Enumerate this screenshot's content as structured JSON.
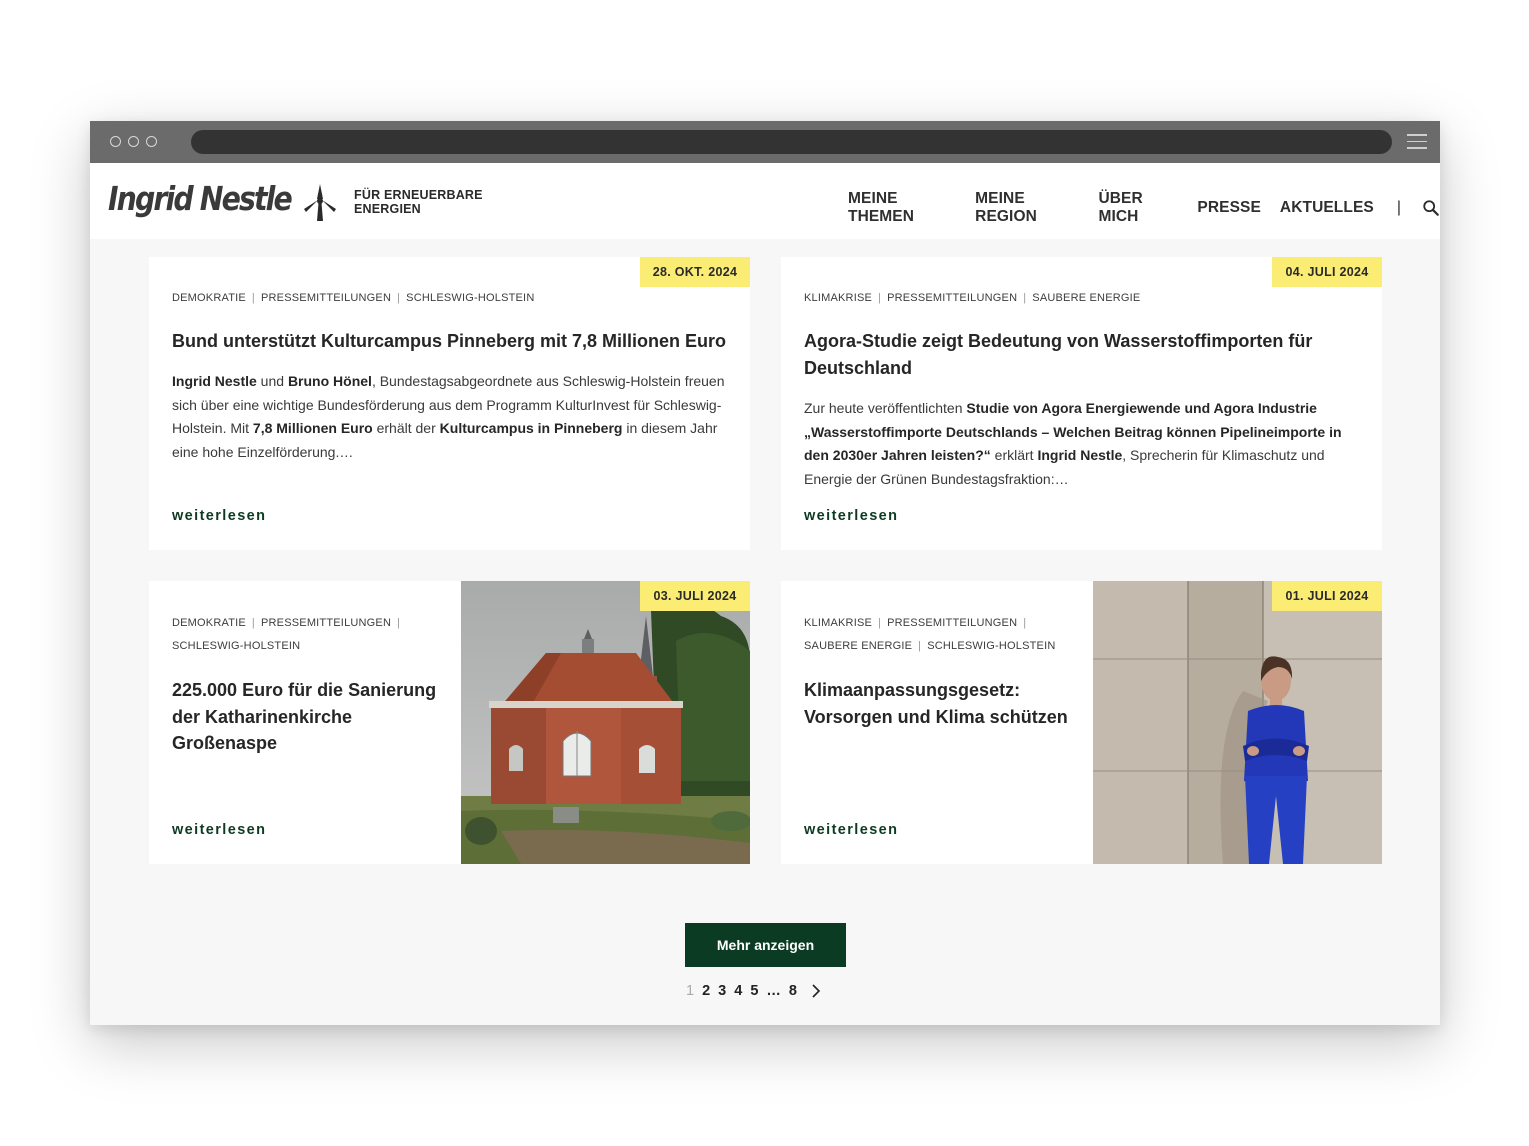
{
  "header": {
    "logo": "Ingrid Nestle",
    "tagline_line1": "FÜR ERNEUERBARE",
    "tagline_line2": "ENERGIEN",
    "nav": [
      "MEINE THEMEN",
      "MEINE REGION",
      "ÜBER MICH",
      "PRESSE",
      "AKTUELLES"
    ],
    "nav_separator": "|"
  },
  "posts": [
    {
      "date": "28. OKT. 2024",
      "tags": [
        "DEMOKRATIE",
        "PRESSEMITTEILUNGEN",
        "SCHLESWIG-HOLSTEIN"
      ],
      "title": "Bund unterstützt Kulturcampus Pinneberg mit 7,8 Millionen Euro",
      "excerpt": {
        "p1": "Ingrid Nestle",
        "p2": " und ",
        "p3": "Bruno Hönel",
        "p4": ", Bundestagsabgeordnete aus Schleswig-Holstein freuen sich über eine wichtige Bundesförderung aus dem Programm KulturInvest für Schleswig-Holstein. Mit ",
        "p5": "7,8 Millionen Euro",
        "p6": " erhält der ",
        "p7": "Kulturcampus in Pinneberg",
        "p8": " in diesem Jahr eine hohe Einzelförderung.…"
      },
      "more": "weiterlesen"
    },
    {
      "date": "04. JULI 2024",
      "tags": [
        "KLIMAKRISE",
        "PRESSEMITTEILUNGEN",
        "SAUBERE ENERGIE"
      ],
      "title": "Agora-Studie zeigt Bedeutung von Wasserstoffimporten für Deutschland",
      "excerpt": {
        "p1": "Zur heute veröffentlichten ",
        "p2": "Studie von Agora Energiewende und Agora Industrie „Wasserstoffimporte Deutschlands – Welchen Beitrag können Pipelineimporte in den 2030er Jahren leisten?“",
        "p3": " erklärt ",
        "p4": "Ingrid Nestle",
        "p5": ", Sprecherin für Klimaschutz und Energie der Grünen Bundestagsfraktion:…"
      },
      "more": "weiterlesen"
    },
    {
      "date": "03. JULI 2024",
      "tags": [
        "DEMOKRATIE",
        "PRESSEMITTEILUNGEN",
        "SCHLESWIG-HOLSTEIN"
      ],
      "title": "225.000 Euro für die Sanierung der Katharinenkirche Großenaspe",
      "more": "weiterlesen"
    },
    {
      "date": "01. JULI 2024",
      "tags": [
        "KLIMAKRISE",
        "PRESSEMITTEILUNGEN",
        "SAUBERE ENERGIE",
        "SCHLESWIG-HOLSTEIN"
      ],
      "title": "Klimaanpassungsgesetz: Vorsorgen und Klima schützen",
      "more": "weiterlesen"
    }
  ],
  "load_more": "Mehr anzeigen",
  "pagination": {
    "pages": [
      "1",
      "2",
      "3",
      "4",
      "5"
    ],
    "ellipsis": "…",
    "last": "8",
    "next": "›"
  },
  "colors": {
    "accent_green": "#0c3b24",
    "badge_yellow": "#fbec74",
    "page_bg": "#f7f7f7"
  },
  "icons": [
    "wind-turbine-icon",
    "search-icon",
    "chevron-right-icon",
    "hamburger-icon"
  ]
}
